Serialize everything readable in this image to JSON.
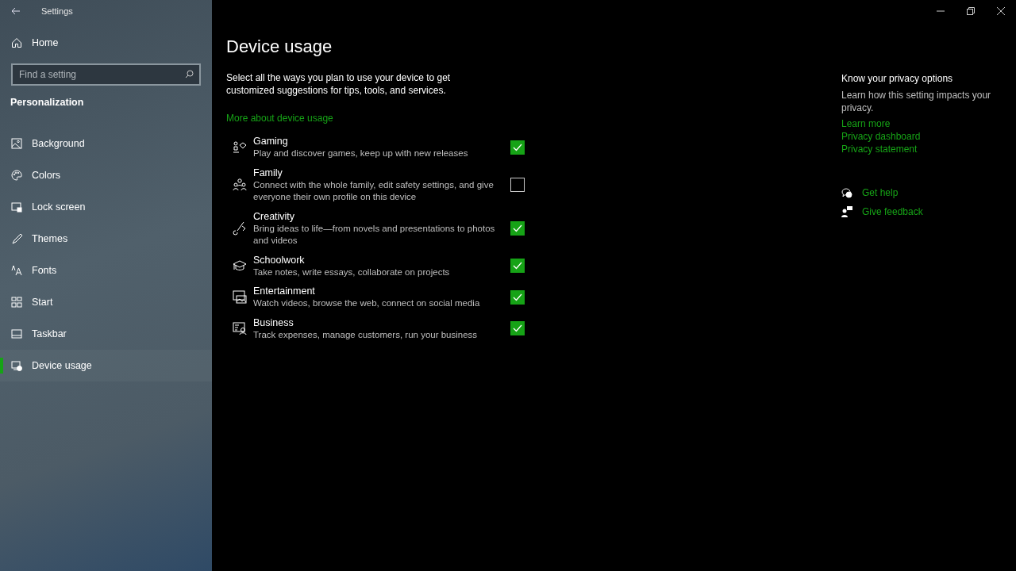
{
  "window": {
    "title": "Settings"
  },
  "sidebar": {
    "home": "Home",
    "search": {
      "placeholder": "Find a setting"
    },
    "section": "Personalization",
    "items": [
      {
        "label": "Background",
        "selected": false
      },
      {
        "label": "Colors",
        "selected": false
      },
      {
        "label": "Lock screen",
        "selected": false
      },
      {
        "label": "Themes",
        "selected": false
      },
      {
        "label": "Fonts",
        "selected": false
      },
      {
        "label": "Start",
        "selected": false
      },
      {
        "label": "Taskbar",
        "selected": false
      },
      {
        "label": "Device usage",
        "selected": true
      }
    ]
  },
  "page": {
    "title": "Device usage",
    "intro": "Select all the ways you plan to use your device to get customized suggestions for tips, tools, and services.",
    "link": "More about device usage",
    "options": [
      {
        "title": "Gaming",
        "description": "Play and discover games, keep up with new releases",
        "checked": true
      },
      {
        "title": "Family",
        "description": "Connect with the whole family, edit safety settings, and give everyone their own profile on this device",
        "checked": false
      },
      {
        "title": "Creativity",
        "description": "Bring ideas to life—from novels and presentations to photos and videos",
        "checked": true
      },
      {
        "title": "Schoolwork",
        "description": "Take notes, write essays, collaborate on projects",
        "checked": true
      },
      {
        "title": "Entertainment",
        "description": "Watch videos, browse the web, connect on social media",
        "checked": true
      },
      {
        "title": "Business",
        "description": "Track expenses, manage customers, run your business",
        "checked": true
      }
    ]
  },
  "aside": {
    "title": "Know your privacy options",
    "text": "Learn how this setting impacts your privacy.",
    "links": [
      "Learn more",
      "Privacy dashboard",
      "Privacy statement"
    ],
    "help": [
      {
        "label": "Get help"
      },
      {
        "label": "Give feedback"
      }
    ]
  }
}
